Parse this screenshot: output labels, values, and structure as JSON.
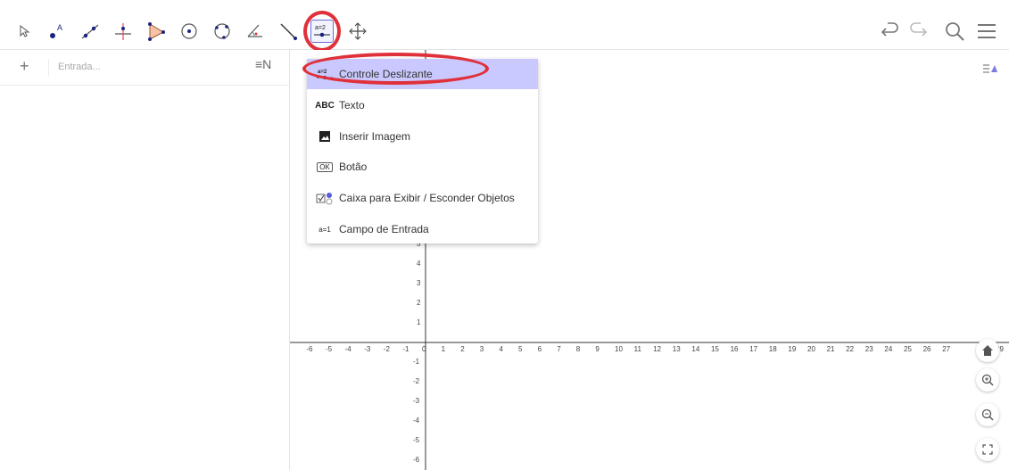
{
  "toolbar": {
    "tools": [
      {
        "name": "move-tool-icon"
      },
      {
        "name": "point-tool-icon"
      },
      {
        "name": "line-tool-icon"
      },
      {
        "name": "perpendicular-line-tool-icon"
      },
      {
        "name": "polygon-tool-icon"
      },
      {
        "name": "circle-tool-icon"
      },
      {
        "name": "circle-through-points-tool-icon"
      },
      {
        "name": "angle-tool-icon"
      },
      {
        "name": "reflect-tool-icon"
      },
      {
        "name": "slider-tool-icon",
        "label": "a=2",
        "active": true
      },
      {
        "name": "move-graphics-tool-icon"
      }
    ],
    "right": [
      "undo-icon",
      "redo-icon",
      "search-icon",
      "menu-icon"
    ]
  },
  "algebra": {
    "add_symbol": "+",
    "input_placeholder": "Entrada...",
    "options_symbol": "≡N"
  },
  "menu": {
    "items": [
      {
        "label": "Controle Deslizante",
        "icon": "slider-icon",
        "icon_text": "a=2",
        "selected": true
      },
      {
        "label": "Texto",
        "icon": "text-icon",
        "icon_text": "ABC"
      },
      {
        "label": "Inserir Imagem",
        "icon": "image-icon",
        "icon_text": ""
      },
      {
        "label": "Botão",
        "icon": "button-icon",
        "icon_text": "OK"
      },
      {
        "label": "Caixa para Exibir / Esconder Objetos",
        "icon": "checkbox-icon",
        "icon_text": "☑"
      },
      {
        "label": "Campo de Entrada",
        "icon": "input-box-icon",
        "icon_text": "a=1"
      }
    ]
  },
  "graphics": {
    "x_ticks": [
      "-6",
      "-5",
      "-4",
      "-3",
      "-2",
      "-1",
      "0",
      "1",
      "2",
      "3",
      "4",
      "5",
      "6",
      "7",
      "8",
      "9",
      "10",
      "11",
      "12",
      "13",
      "14",
      "15",
      "16",
      "17",
      "18",
      "19",
      "20",
      "21",
      "22",
      "23",
      "24",
      "25",
      "26",
      "27",
      "29"
    ],
    "y_ticks_pos": [
      "5",
      "4",
      "3",
      "2",
      "1"
    ],
    "y_ticks_neg": [
      "-1",
      "-2",
      "-3",
      "-4",
      "-5",
      "-6"
    ]
  },
  "side_buttons": [
    "home-icon",
    "zoom-in-icon",
    "zoom-out-icon",
    "fullscreen-icon"
  ],
  "colors": {
    "accent": "#6b6bd6",
    "highlight": "#c9c9ff",
    "annotation": "#e0303a"
  }
}
